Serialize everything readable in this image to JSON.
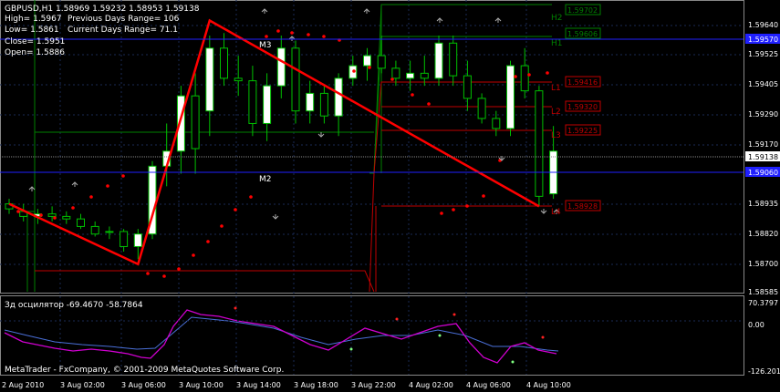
{
  "header": {
    "symbol_line": "GBPUSD,H1  1.58969 1.59232 1.58953 1.59138",
    "high": "High= 1.5967",
    "prev_range": "Previous Days Range= 106",
    "low": "Low= 1.5861",
    "curr_range": "Current Days Range= 71.1",
    "close": "Close= 1.5951",
    "open": "Open= 1.5886"
  },
  "labels": {
    "m3": "M3",
    "m2": "M2",
    "h2": "H2",
    "h1": "H1",
    "l1": "L1",
    "l2": "L2",
    "l3": "L3",
    "l4": "L4"
  },
  "levels": {
    "h2": "1.59702",
    "h1": "1.59606",
    "l1": "1.59416",
    "l2": "1.59320",
    "l3": "1.59225",
    "l4": "1.58928"
  },
  "price_axis": {
    "ticks": [
      "1.59640",
      "1.59525",
      "1.59405",
      "1.59290",
      "1.59170",
      "1.58935",
      "1.58820",
      "1.58700",
      "1.58585"
    ],
    "current_bid": "1.59138",
    "blue_tag_top": "1.59570",
    "blue_tag_mid": "1.59060"
  },
  "time_axis": {
    "ticks": [
      "2 Aug 2010",
      "3 Aug 02:00",
      "3 Aug 06:00",
      "3 Aug 10:00",
      "3 Aug 14:00",
      "3 Aug 18:00",
      "3 Aug 22:00",
      "4 Aug 02:00",
      "4 Aug 06:00",
      "4 Aug 10:00"
    ]
  },
  "oscillator": {
    "title": "Зд осцилятор -69.4670 -58.7864",
    "ticks": [
      "70.3797",
      "0.00",
      "-126.2018"
    ]
  },
  "copyright": "MetaTrader - FxCompany, © 2001-2009 MetaQuotes Software Corp.",
  "colors": {
    "background": "#000000",
    "grid": "#1a2a55",
    "bull": "#ffffff",
    "bear": "#000000",
    "wick": "#00c000",
    "zigzag": "#ff0000",
    "sar": "#ff0000",
    "pivot_green": "#008000",
    "pivot_red": "#c00000",
    "blue_line": "#2020ff",
    "osc_magenta": "#d000d0",
    "osc_blue": "#4a6fd8"
  },
  "chart_data": {
    "type": "candlestick",
    "candles": [
      [
        1.5893,
        1.5895,
        1.5889,
        1.5891
      ],
      [
        1.589,
        1.5893,
        1.5886,
        1.5888
      ],
      [
        1.5888,
        1.5891,
        1.5885,
        1.5889
      ],
      [
        1.5889,
        1.5892,
        1.5886,
        1.5888
      ],
      [
        1.5888,
        1.589,
        1.5885,
        1.5887
      ],
      [
        1.5887,
        1.5889,
        1.5883,
        1.5884
      ],
      [
        1.5884,
        1.5886,
        1.588,
        1.5881
      ],
      [
        1.5882,
        1.5884,
        1.5879,
        1.5882
      ],
      [
        1.5882,
        1.5883,
        1.5874,
        1.5876
      ],
      [
        1.5876,
        1.5883,
        1.5871,
        1.5881
      ],
      [
        1.5881,
        1.591,
        1.5879,
        1.5908
      ],
      [
        1.5908,
        1.5925,
        1.59,
        1.5914
      ],
      [
        1.5914,
        1.594,
        1.5905,
        1.5936
      ],
      [
        1.5936,
        1.5945,
        1.5905,
        1.5915
      ],
      [
        1.593,
        1.596,
        1.592,
        1.5955
      ],
      [
        1.5955,
        1.5961,
        1.594,
        1.5943
      ],
      [
        1.5943,
        1.5952,
        1.5936,
        1.5942
      ],
      [
        1.5942,
        1.5948,
        1.592,
        1.5925
      ],
      [
        1.5925,
        1.5945,
        1.5918,
        1.594
      ],
      [
        1.594,
        1.596,
        1.5935,
        1.5955
      ],
      [
        1.5955,
        1.5958,
        1.5925,
        1.593
      ],
      [
        1.593,
        1.5942,
        1.5925,
        1.5937
      ],
      [
        1.5937,
        1.594,
        1.5925,
        1.5928
      ],
      [
        1.5928,
        1.5945,
        1.592,
        1.5943
      ],
      [
        1.5943,
        1.5952,
        1.594,
        1.5948
      ],
      [
        1.5948,
        1.5955,
        1.5942,
        1.5952
      ],
      [
        1.5952,
        1.596,
        1.5945,
        1.5947
      ],
      [
        1.5947,
        1.595,
        1.594,
        1.5943
      ],
      [
        1.5943,
        1.595,
        1.5938,
        1.5945
      ],
      [
        1.5945,
        1.5952,
        1.594,
        1.5943
      ],
      [
        1.5943,
        1.596,
        1.594,
        1.5957
      ],
      [
        1.5957,
        1.596,
        1.594,
        1.5944
      ],
      [
        1.5944,
        1.595,
        1.593,
        1.5935
      ],
      [
        1.5935,
        1.5937,
        1.5925,
        1.5927
      ],
      [
        1.5927,
        1.593,
        1.592,
        1.5923
      ],
      [
        1.5923,
        1.595,
        1.592,
        1.5948
      ],
      [
        1.5948,
        1.5955,
        1.5935,
        1.5938
      ],
      [
        1.5938,
        1.594,
        1.5892,
        1.5896
      ],
      [
        1.5897,
        1.5924,
        1.5895,
        1.5914
      ]
    ],
    "zigzag": [
      {
        "bar": 0,
        "price": 1.5893
      },
      {
        "bar": 9,
        "price": 1.5869
      },
      {
        "bar": 14,
        "price": 1.5966
      },
      {
        "bar": 37,
        "price": 1.5892
      }
    ]
  }
}
